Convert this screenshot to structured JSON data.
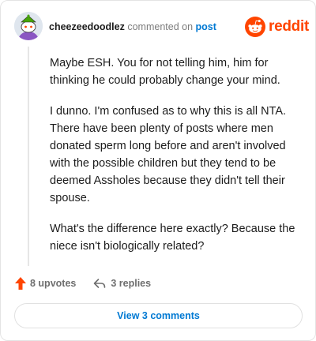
{
  "header": {
    "username": "cheezeedoodlez",
    "action_text": "commented on",
    "post_link": "post"
  },
  "logo": {
    "wordmark": "reddit",
    "icon": "reddit-snoo-icon",
    "color": "#ff4500"
  },
  "comment": {
    "paragraphs": [
      "Maybe ESH. You for not telling him, him for thinking he could probably change your mind.",
      "I dunno. I'm confused as to why this is all NTA. There have been plenty of posts where men donated sperm long before and aren't involved with the possible children but they tend to be deemed Assholes because they didn't tell their spouse.",
      "What's the difference here exactly? Because the niece isn't biologically related?"
    ]
  },
  "actions": {
    "upvotes_label": "8 upvotes",
    "upvote_icon": "upvote-arrow-icon",
    "upvote_color": "#ff4500",
    "replies_label": "3 replies",
    "reply_icon": "reply-arrow-icon"
  },
  "view_comments": {
    "label": "View 3 comments",
    "color": "#0079d3"
  }
}
